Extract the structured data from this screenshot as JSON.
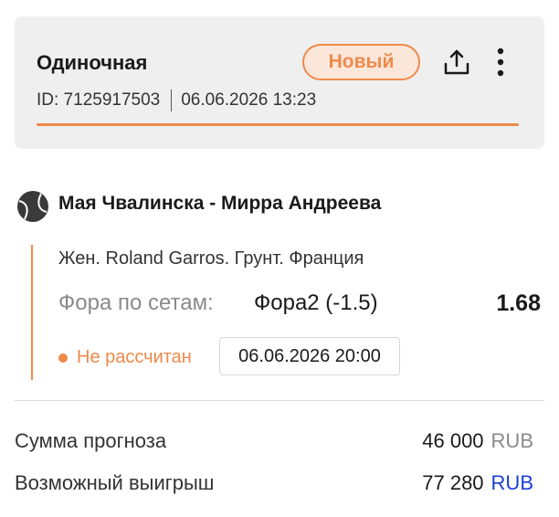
{
  "bet": {
    "type_label": "Одиночная",
    "badge": "Новый",
    "id_text": "ID: 7125917503",
    "datetime": "06.06.2026 13:23"
  },
  "icons": {
    "share": "share-icon",
    "more": "more-vertical-icon",
    "sport": "tennis-ball-icon"
  },
  "event": {
    "title": "Мая Чвалинска - Мирра Андреева",
    "tournament": "Жен. Roland Garros. Грунт. Франция",
    "market_label": "Фора по сетам:",
    "selection": "Фора2 (-1.5)",
    "odds": "1.68",
    "status": "Не рассчитан",
    "start_time": "06.06.2026 20:00"
  },
  "summary": {
    "stake_label": "Сумма прогноза",
    "stake_amount": "46 000",
    "stake_currency": "RUB",
    "payout_label": "Возможный выигрыш",
    "payout_amount": "77 280",
    "payout_currency": "RUB"
  },
  "colors": {
    "accent": "#ee8a4b",
    "badge_bg": "#fbe6da",
    "card_bg": "#efefef",
    "link_blue": "#1a3fd8"
  }
}
